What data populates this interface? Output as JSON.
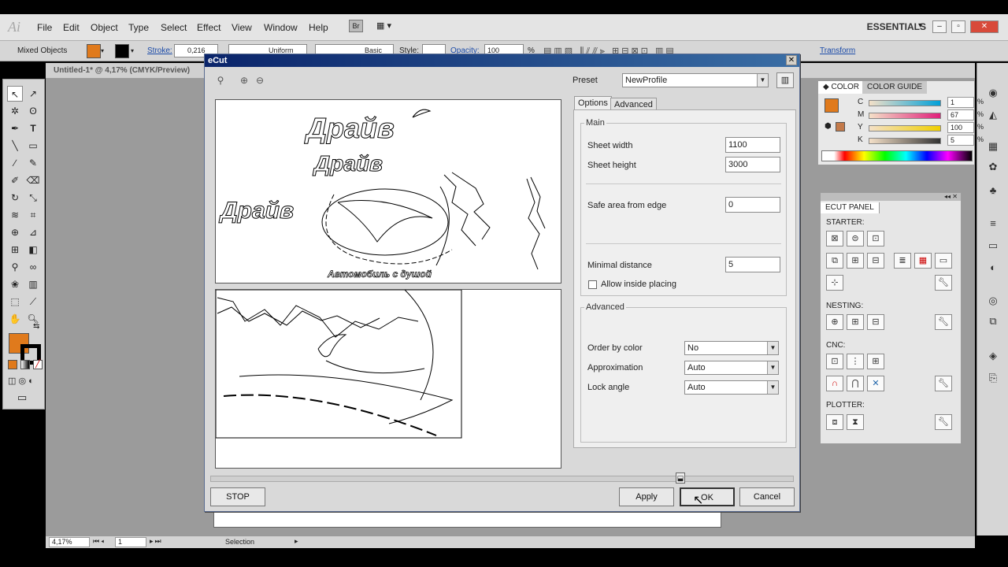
{
  "menubar": {
    "logo": "Ai",
    "items": [
      "File",
      "Edit",
      "Object",
      "Type",
      "Select",
      "Effect",
      "View",
      "Window",
      "Help"
    ],
    "bridge": "Br",
    "workspace": "ESSENTIALS"
  },
  "controlbar": {
    "selection": "Mixed Objects",
    "stroke_label": "Stroke:",
    "stroke_value": "0,216",
    "profile": "Uniform",
    "brush": "Basic",
    "style_label": "Style:",
    "opacity_label": "Opacity:",
    "opacity_value": "100",
    "opacity_unit": "%",
    "transform": "Transform",
    "fill_color": "#e07a1c"
  },
  "document": {
    "tab": "Untitled-1* @ 4,17% (CMYK/Preview)"
  },
  "dialog": {
    "title": "eCut",
    "preset_label": "Preset",
    "preset_value": "NewProfile",
    "tabs": [
      "Options",
      "Advanced"
    ],
    "main_group": "Main",
    "sheet_width_label": "Sheet width",
    "sheet_width": "1100",
    "sheet_height_label": "Sheet height",
    "sheet_height": "3000",
    "safe_area_label": "Safe area from edge",
    "safe_area": "0",
    "min_distance_label": "Minimal distance",
    "min_distance": "5",
    "allow_inside_label": "Allow inside placing",
    "advanced_group": "Advanced",
    "order_label": "Order by color",
    "order_value": "No",
    "approx_label": "Approximation",
    "approx_value": "Auto",
    "lock_label": "Lock angle",
    "lock_value": "Auto",
    "stop": "STOP",
    "apply": "Apply",
    "ok": "OK",
    "cancel": "Cancel",
    "preview": {
      "logo_text": "Драйв",
      "tagline": "Автомобиль с душой"
    }
  },
  "color_panel": {
    "tab_color": "COLOR",
    "tab_guide": "COLOR GUIDE",
    "channels": [
      {
        "label": "C",
        "value": "1",
        "color": "#00a0d8"
      },
      {
        "label": "M",
        "value": "67",
        "color": "#e0207a"
      },
      {
        "label": "Y",
        "value": "100",
        "color": "#f0d000"
      },
      {
        "label": "K",
        "value": "5",
        "color": "#333333"
      }
    ],
    "pct": "%"
  },
  "ecut_panel": {
    "title": "ECUT PANEL",
    "sections": [
      "STARTER:",
      "NESTING:",
      "CNC:",
      "PLOTTER:"
    ]
  },
  "statusbar": {
    "zoom": "4,17%",
    "page": "1",
    "mode": "Selection"
  }
}
